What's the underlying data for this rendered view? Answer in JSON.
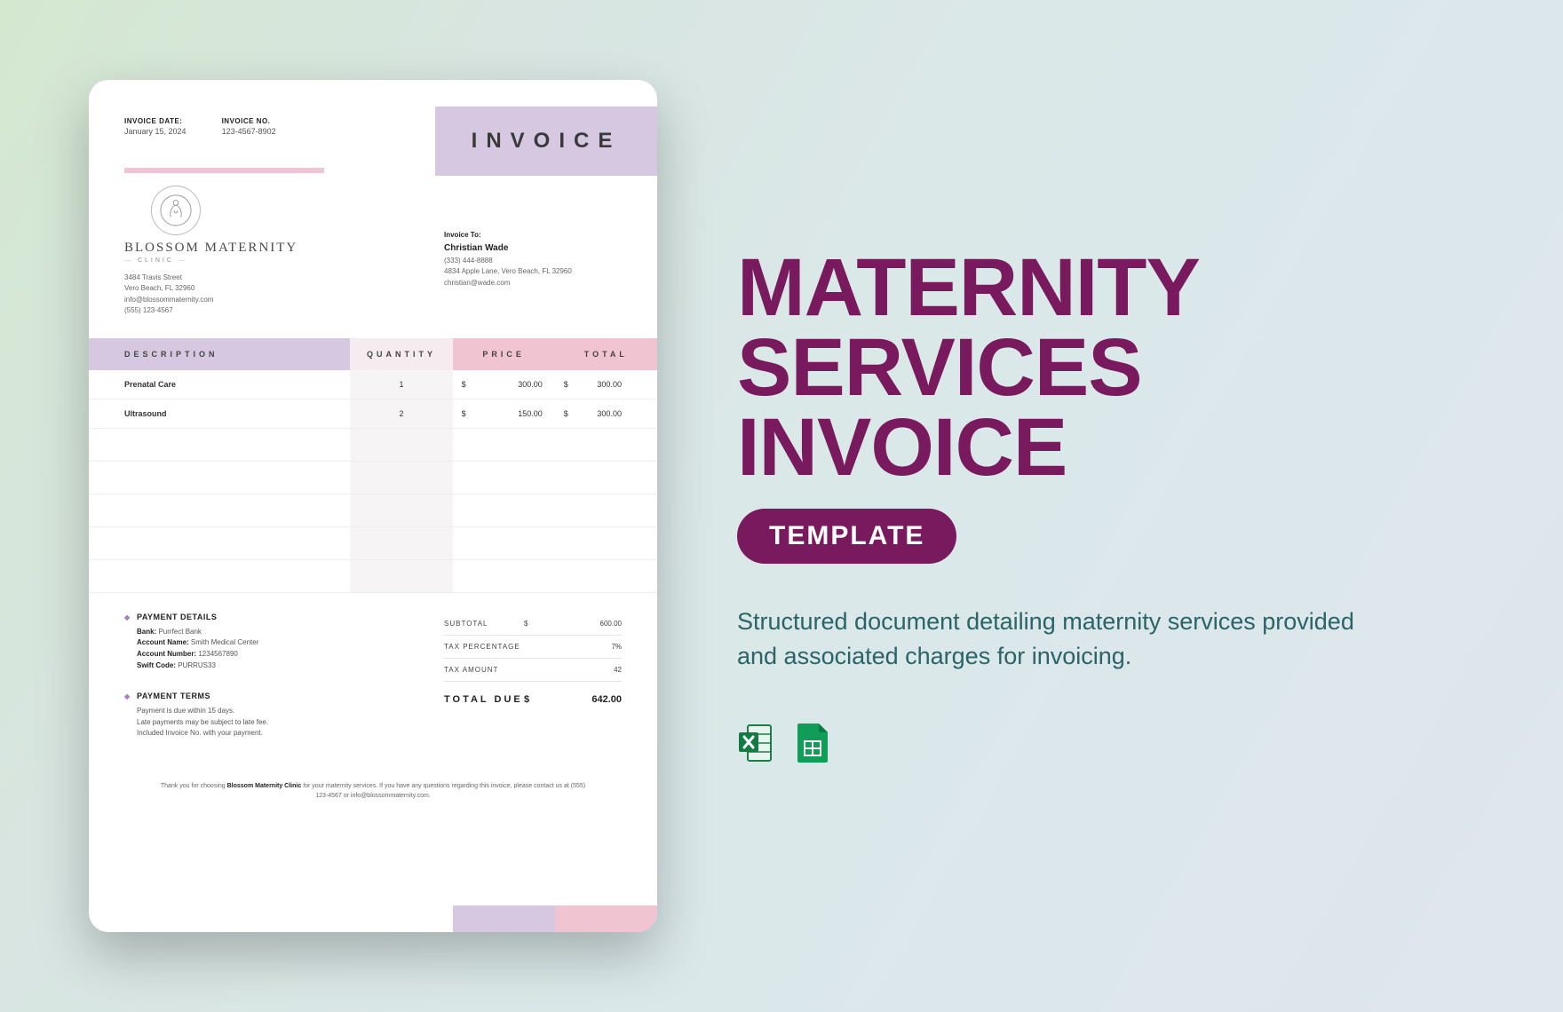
{
  "hero": {
    "title_line1": "MATERNITY",
    "title_line2": "SERVICES",
    "title_line3": "INVOICE",
    "pill": "TEMPLATE",
    "description": "Structured document detailing maternity services provided and associated charges for invoicing."
  },
  "file_formats": [
    "excel",
    "google-sheets"
  ],
  "invoice": {
    "banner": "INVOICE",
    "meta": {
      "date_label": "INVOICE DATE:",
      "date_value": "January 15, 2024",
      "no_label": "INVOICE NO.",
      "no_value": "123-4567-8902"
    },
    "company": {
      "name": "BLOSSOM MATERNITY",
      "subtitle": "CLINIC",
      "address": "3484 Travis Street",
      "city": "Vero Beach, FL 32960",
      "email": "info@blossommaternity.com",
      "phone": "(555) 123-4567"
    },
    "bill_to": {
      "label": "Invoice To:",
      "name": "Christian Wade",
      "phone": "(333) 444-8888",
      "address": "4834 Apple Lane, Vero Beach, FL 32960",
      "email": "christian@wade.com"
    },
    "columns": {
      "description": "DESCRIPTION",
      "quantity": "QUANTITY",
      "price": "PRICE",
      "total": "TOTAL"
    },
    "items": [
      {
        "description": "Prenatal Care",
        "quantity": "1",
        "price": "300.00",
        "total": "300.00"
      },
      {
        "description": "Ultrasound",
        "quantity": "2",
        "price": "150.00",
        "total": "300.00"
      }
    ],
    "payment_details": {
      "title": "PAYMENT DETAILS",
      "bank_label": "Bank:",
      "bank": "Purrfect Bank",
      "acct_name_label": "Account Name:",
      "acct_name": "Smith Medical Center",
      "acct_no_label": "Account Number:",
      "acct_no": "1234567890",
      "swift_label": "Swift Code:",
      "swift": "PURRUS33"
    },
    "payment_terms": {
      "title": "PAYMENT TERMS",
      "line1": "Payment is due within 15 days.",
      "line2": "Late payments may be subject to late fee.",
      "line3": "Included Invoice No. with your payment."
    },
    "totals": {
      "subtotal_label": "SUBTOTAL",
      "subtotal": "600.00",
      "tax_pct_label": "TAX PERCENTAGE",
      "tax_pct": "7%",
      "tax_amt_label": "TAX AMOUNT",
      "tax_amt": "42",
      "due_label": "TOTAL DUE",
      "due": "642.00"
    },
    "thanks_prefix": "Thank you for choosing ",
    "thanks_company": "Blossom Maternity Clinic",
    "thanks_suffix": " for your maternity services. If you have any questions regarding this invoice, please contact us at (555) 123-4567 or info@blossommaternity.com."
  }
}
